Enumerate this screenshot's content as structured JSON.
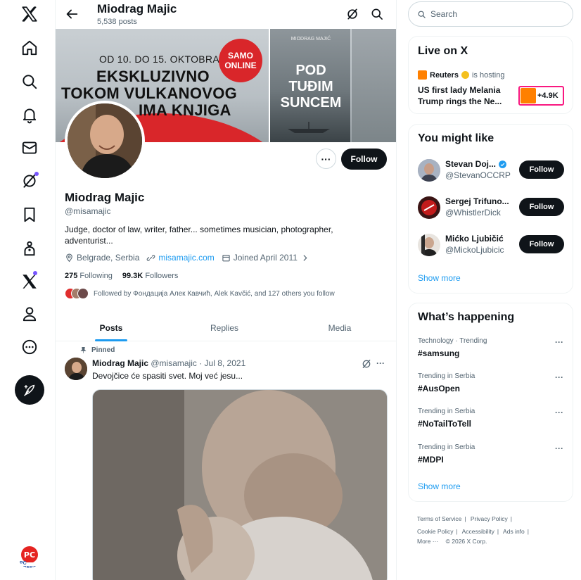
{
  "nav": {
    "items": [
      "x-logo",
      "home",
      "explore",
      "notifications",
      "messages",
      "grok",
      "bookmarks",
      "communities",
      "premium",
      "profile",
      "more"
    ],
    "account_badge": "PC PRESS"
  },
  "profile": {
    "top_name": "Miodrag Majic",
    "post_count": "5,538 posts",
    "name": "Miodrag Majic",
    "handle": "@misamajic",
    "bio": "Judge, doctor of law, writer, father... sometimes musician, photographer, adventurist...",
    "location": "Belgrade, Serbia",
    "website": "misamajic.com",
    "joined": "Joined April 2011",
    "following_count": "275",
    "following_label": "Following",
    "followers_count": "99.3K",
    "followers_label": "Followers",
    "followed_by": "Followed by Фондација Алек Кавчић, Alek Kavčić, and 127 others you follow",
    "follow_label": "Follow",
    "more_label": "···"
  },
  "banner": {
    "line1": "OD 10. DO 15. OKTOBRA",
    "line2": "EKSKLUZIVNO",
    "line3": "TOKOM VULKANOVOG",
    "line4": "IMA KNJIGA",
    "badge_top": "SAMO",
    "badge_bottom": "ONLINE",
    "book_author": "MIODRAG MAJIĆ",
    "book_title_1": "POD",
    "book_title_2": "TUĐIM",
    "book_title_3": "SUNCEM"
  },
  "tabs": [
    {
      "label": "Posts",
      "active": true
    },
    {
      "label": "Replies",
      "active": false
    },
    {
      "label": "Media",
      "active": false
    }
  ],
  "post": {
    "pinned_label": "Pinned",
    "author": "Miodrag Majic",
    "handle_date": "@misamajic · Jul 8, 2021",
    "text": "Devojčice će spasiti svet. Moj već jesu...",
    "more": "···"
  },
  "search": {
    "placeholder": "Search"
  },
  "live": {
    "title": "Live on X",
    "host_name": "Reuters",
    "host_suffix": "is hosting",
    "headline": "US first lady Melania Trump rings the Ne...",
    "badge": "+4.9K"
  },
  "suggestions": {
    "title": "You might like",
    "items": [
      {
        "name": "Stevan Doj...",
        "handle": "@StevanOCCRP",
        "verified": true,
        "button": "Follow"
      },
      {
        "name": "Sergej Trifuno...",
        "handle": "@WhistlerDick",
        "verified": false,
        "button": "Follow"
      },
      {
        "name": "Mićko Ljubičić",
        "handle": "@MickoLjubicic",
        "verified": false,
        "button": "Follow"
      }
    ],
    "show_more": "Show more"
  },
  "trends": {
    "title": "What’s happening",
    "items": [
      {
        "category": "Technology · Trending",
        "name": "#samsung"
      },
      {
        "category": "Trending in Serbia",
        "name": "#AusOpen"
      },
      {
        "category": "Trending in Serbia",
        "name": "#NoTailToTell"
      },
      {
        "category": "Trending in Serbia",
        "name": "#MDPI"
      }
    ],
    "show_more": "Show more"
  },
  "footer": {
    "terms": "Terms of Service",
    "privacy": "Privacy Policy",
    "cookie": "Cookie Policy",
    "accessibility": "Accessibility",
    "ads": "Ads info",
    "more": "More ···",
    "copyright": "© 2026 X Corp."
  },
  "colors": {
    "accent": "#1d9bf0",
    "grok_dot": "#7856ff",
    "banner_red": "#d9262a",
    "live_border": "#f91880"
  }
}
